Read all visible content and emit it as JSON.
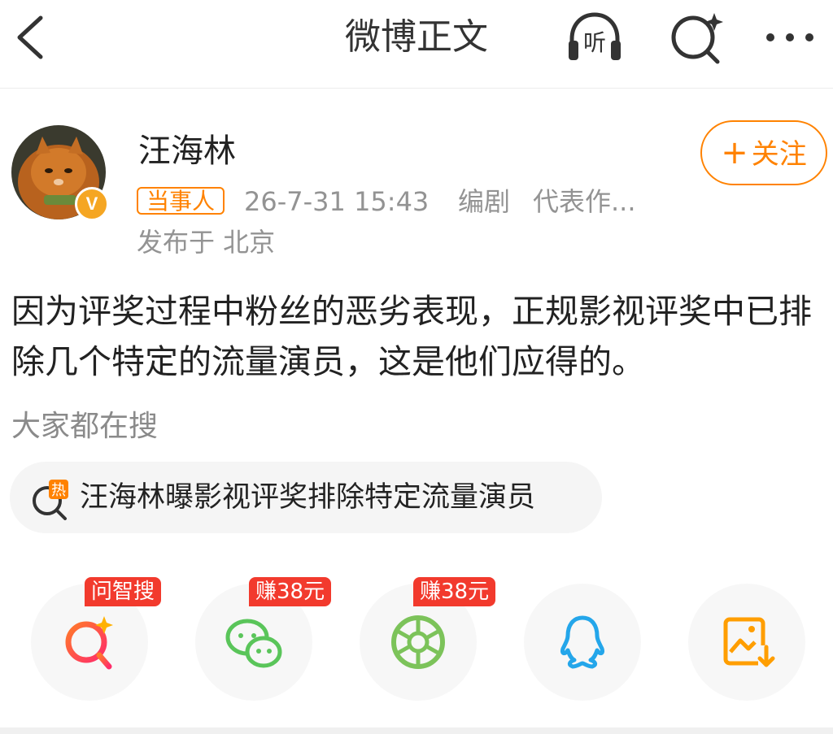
{
  "header": {
    "title": "微博正文",
    "listen_label": "听"
  },
  "post": {
    "author": {
      "name": "汪海林",
      "badge": "当事人",
      "verified_label": "V"
    },
    "time": "26-7-31 15:43",
    "role": "编剧",
    "works": "代表作...",
    "location": "发布于 北京",
    "follow": {
      "plus": "+",
      "label": "关注"
    },
    "text": "因为评奖过程中粉丝的恶劣表现，正规影视评奖中已排除几个特定的流量演员，这是他们应得的。"
  },
  "search_section": {
    "title": "大家都在搜",
    "hot_item": {
      "label": "汪海林曝影视评奖排除特定流量演员",
      "icon_text": "热"
    }
  },
  "share": {
    "items": [
      {
        "name": "问智搜",
        "badge": "问智搜",
        "icon": "ai-search-icon"
      },
      {
        "name": "微信",
        "badge": "赚38元",
        "icon": "wechat-icon"
      },
      {
        "name": "朋友圈",
        "badge": "赚38元",
        "icon": "moments-icon"
      },
      {
        "name": "QQ",
        "badge": "",
        "icon": "qq-icon"
      },
      {
        "name": "保存图片",
        "badge": "",
        "icon": "save-image-icon"
      }
    ]
  },
  "colors": {
    "accent": "#ff8200",
    "badge_red": "#f23a2d",
    "wechat_green": "#5ac55a",
    "moments_green": "#7cc35a",
    "qq_blue": "#24a6ea",
    "save_orange": "#ff9e00"
  }
}
